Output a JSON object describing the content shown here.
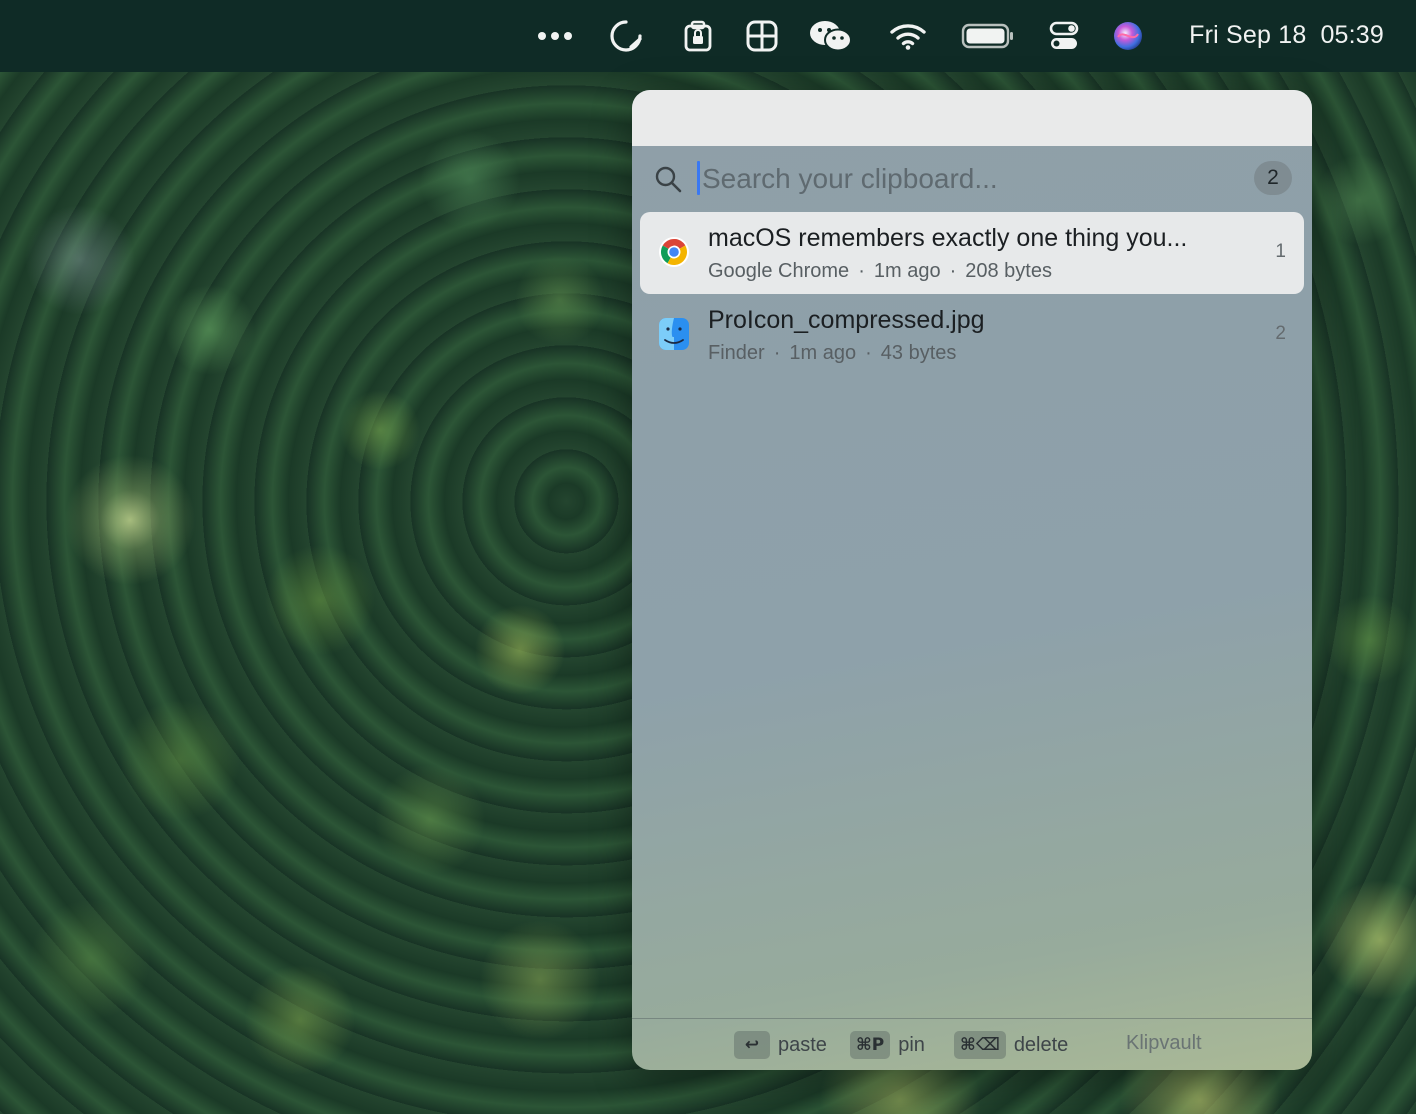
{
  "menubar": {
    "icons": [
      "more-icon",
      "sync-icon",
      "clipboard-lock-icon",
      "grid-icon",
      "wechat-icon",
      "wifi-icon",
      "battery-icon",
      "control-center-icon",
      "siri-icon"
    ],
    "date": "Fri Sep 18",
    "time": "05:39"
  },
  "panel": {
    "search": {
      "placeholder": "Search your clipboard...",
      "value": "",
      "count": "2"
    },
    "items": [
      {
        "title": "macOS remembers exactly one thing you...",
        "app": "Google Chrome",
        "age": "1m ago",
        "size": "208 bytes",
        "index": "1",
        "icon": "chrome-icon",
        "selected": true
      },
      {
        "title": "ProIcon_compressed.jpg",
        "app": "Finder",
        "age": "1m ago",
        "size": "43 bytes",
        "index": "2",
        "icon": "finder-icon",
        "selected": false
      }
    ],
    "footer": {
      "paste_key": "↩",
      "paste_label": "paste",
      "pin_key": "⌘P",
      "pin_label": "pin",
      "delete_key": "⌘⌫",
      "delete_label": "delete",
      "brand": "Klipvault"
    }
  },
  "colors": {
    "menubar": "#0f2b26",
    "caret": "#3a78f2",
    "selected_row": "#e7e9ea"
  }
}
